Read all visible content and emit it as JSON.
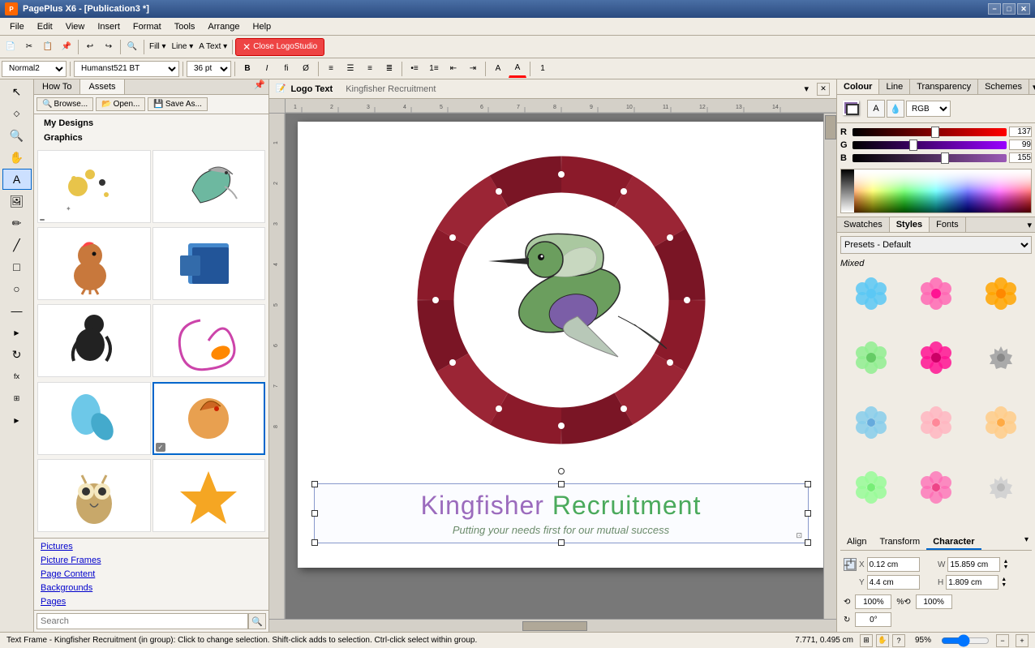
{
  "app": {
    "title": "PagePlus X6 - [Publication3 *]",
    "icon": "P"
  },
  "title_bar": {
    "title": "PagePlus X6 - [Publication3 *]",
    "min": "−",
    "max": "□",
    "close": "✕"
  },
  "menu": {
    "items": [
      "File",
      "Edit",
      "View",
      "Insert",
      "Format",
      "Tools",
      "Arrange",
      "Help"
    ]
  },
  "toolbar1": {
    "close_logo_studio": "Close LogoStudio"
  },
  "text_toolbar": {
    "font_style": "Normal2",
    "font_name": "Humanst521 BT",
    "font_size": "36 pt",
    "bold": "B",
    "italic": "I",
    "ligature": "fi",
    "strikethrough": "Ø"
  },
  "assets_panel": {
    "tab_howto": "How To",
    "tab_assets": "Assets",
    "btn_browse": "Browse...",
    "btn_open": "Open...",
    "btn_save_as": "Save As...",
    "nav_my_designs": "My Designs",
    "nav_graphics": "Graphics",
    "footer_pictures": "Pictures",
    "footer_picture_frames": "Picture Frames",
    "footer_page_content": "Page Content",
    "footer_backgrounds": "Backgrounds",
    "footer_pages": "Pages",
    "search_placeholder": "Search",
    "search_label": "Search"
  },
  "logo_text_bar": {
    "tab": "Logo Text",
    "content": "Kingfisher Recruitment"
  },
  "canvas": {
    "main_text": "Kingfisher Recruitment",
    "sub_text": "Putting your needs first for our mutual success"
  },
  "colour_panel": {
    "tab_colour": "Colour",
    "tab_line": "Line",
    "tab_transparency": "Transparency",
    "tab_schemes": "Schemes",
    "mode": "RGB",
    "r_label": "R",
    "g_label": "G",
    "b_label": "B",
    "r_value": "137",
    "g_value": "99",
    "b_value": "155"
  },
  "styles_panel": {
    "tab_swatches": "Swatches",
    "tab_styles": "Styles",
    "tab_fonts": "Fonts",
    "preset_label": "Presets - Default",
    "mixed_label": "Mixed",
    "flowers": [
      {
        "color": "#5bc8f5",
        "type": "open"
      },
      {
        "color": "#ff69b4",
        "type": "closed"
      },
      {
        "color": "#ffa500",
        "type": "open"
      },
      {
        "color": "#90ee90",
        "type": "open"
      },
      {
        "color": "#ff1493",
        "type": "closed"
      },
      {
        "color": "#808080",
        "type": "gear"
      },
      {
        "color": "#5bc8f5",
        "type": "open2"
      },
      {
        "color": "#ff69b4",
        "type": "closed2"
      },
      {
        "color": "#ffa500",
        "type": "open2"
      },
      {
        "color": "#90ee90",
        "type": "open3"
      },
      {
        "color": "#ff1493",
        "type": "closed3"
      },
      {
        "color": "#d3d3d3",
        "type": "gear2"
      }
    ]
  },
  "atc_panel": {
    "tab_align": "Align",
    "tab_transform": "Transform",
    "tab_character": "Character",
    "x_label": "X",
    "y_label": "Y",
    "w_label": "W",
    "h_label": "H",
    "x_value": "0.12 cm",
    "y_value": "4.4 cm",
    "w_value": "15.859 cm",
    "h_value": "1.809 cm",
    "scale_x": "100%",
    "scale_y": "100%",
    "rotate": "0°"
  },
  "status_bar": {
    "text": "Text Frame - Kingfisher Recruitment (in group): Click to change selection. Shift-click adds to selection. Ctrl-click select within group.",
    "coords": "7.771, 0.495 cm",
    "zoom": "95%"
  }
}
